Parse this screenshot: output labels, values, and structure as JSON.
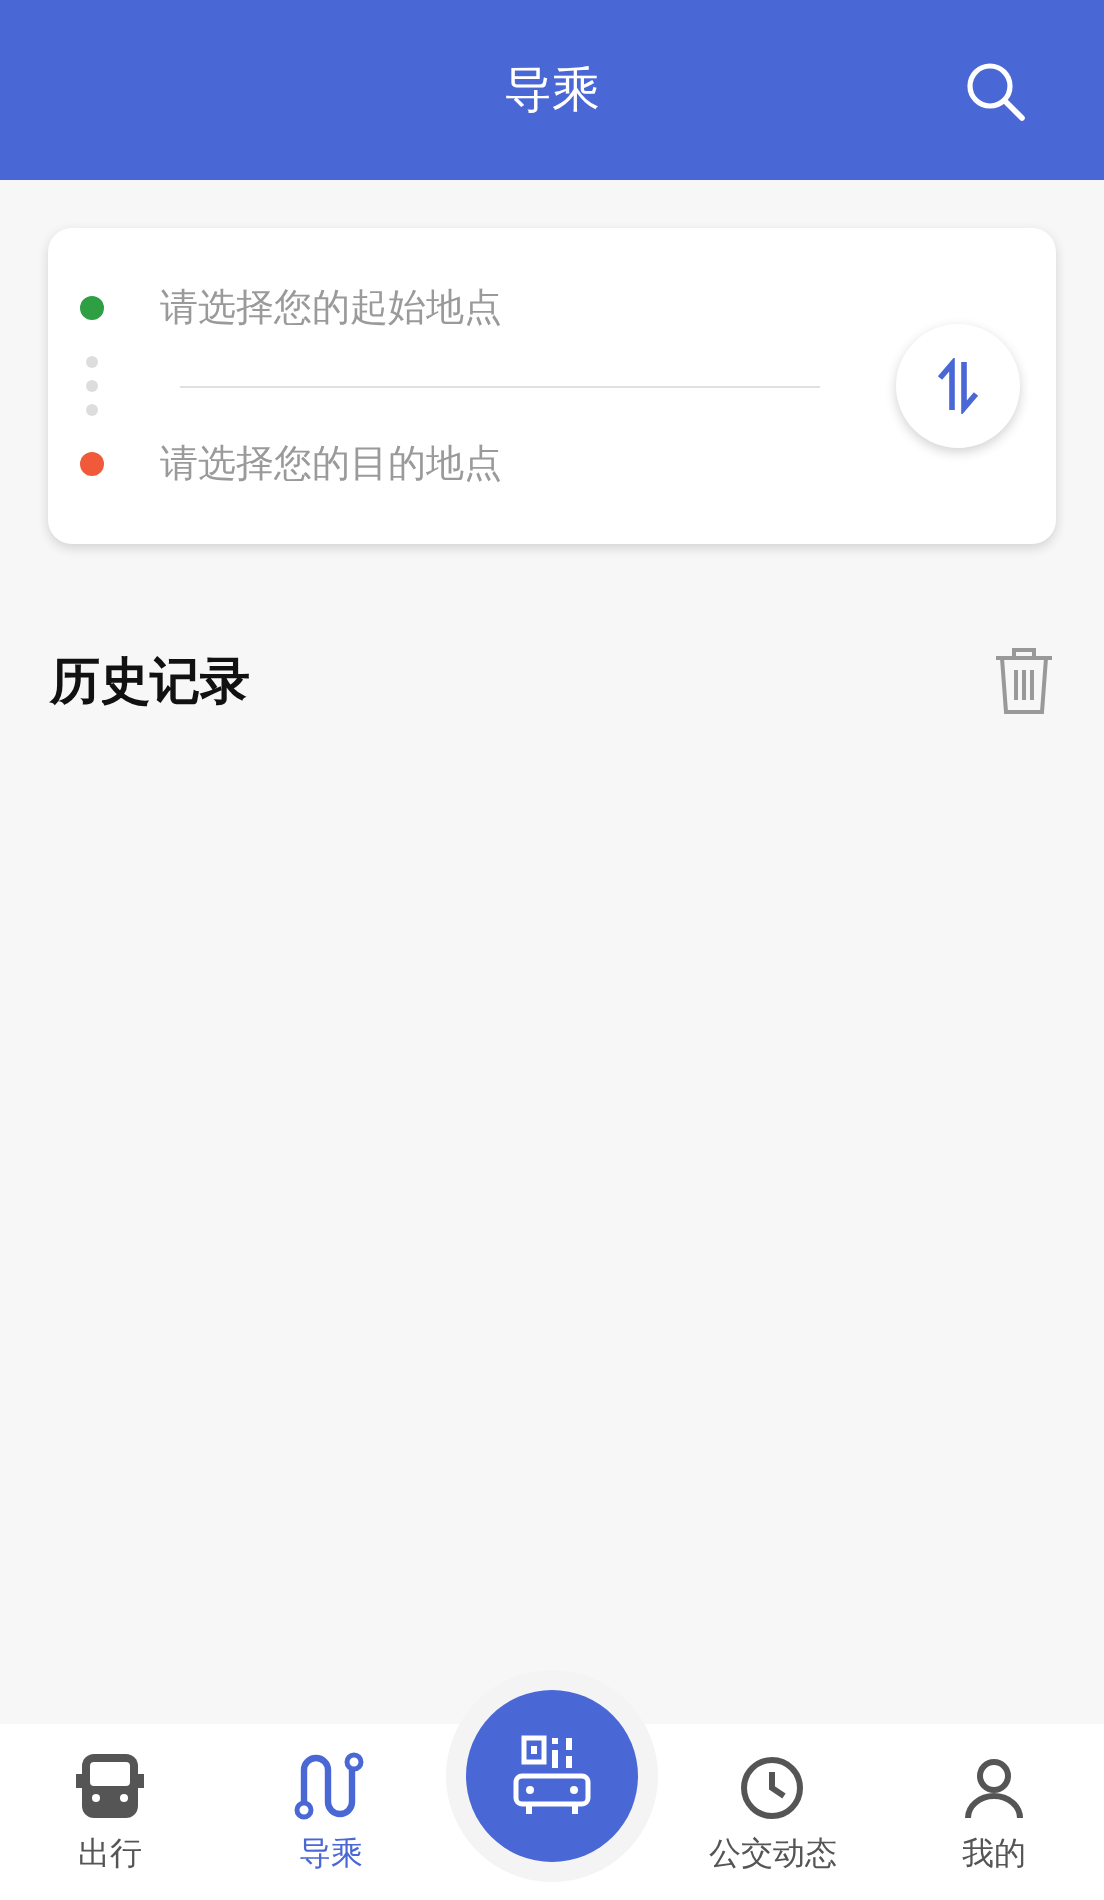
{
  "header": {
    "title": "导乘"
  },
  "route_card": {
    "points": [
      {
        "placeholder": "请选择您的起始地点",
        "color": "#2ea043"
      },
      {
        "placeholder": "请选择您的目的地点",
        "color": "#f0593a"
      }
    ]
  },
  "history": {
    "title": "历史记录"
  },
  "tab_bar": {
    "tabs": [
      {
        "label": "出行",
        "kind": "bus",
        "selected": false
      },
      {
        "label": "导乘",
        "kind": "route",
        "selected": true
      },
      {
        "kind": "scan",
        "selected": false
      },
      {
        "label": "公交动态",
        "kind": "clock",
        "selected": false
      },
      {
        "label": "我的",
        "kind": "person",
        "selected": false
      }
    ]
  }
}
